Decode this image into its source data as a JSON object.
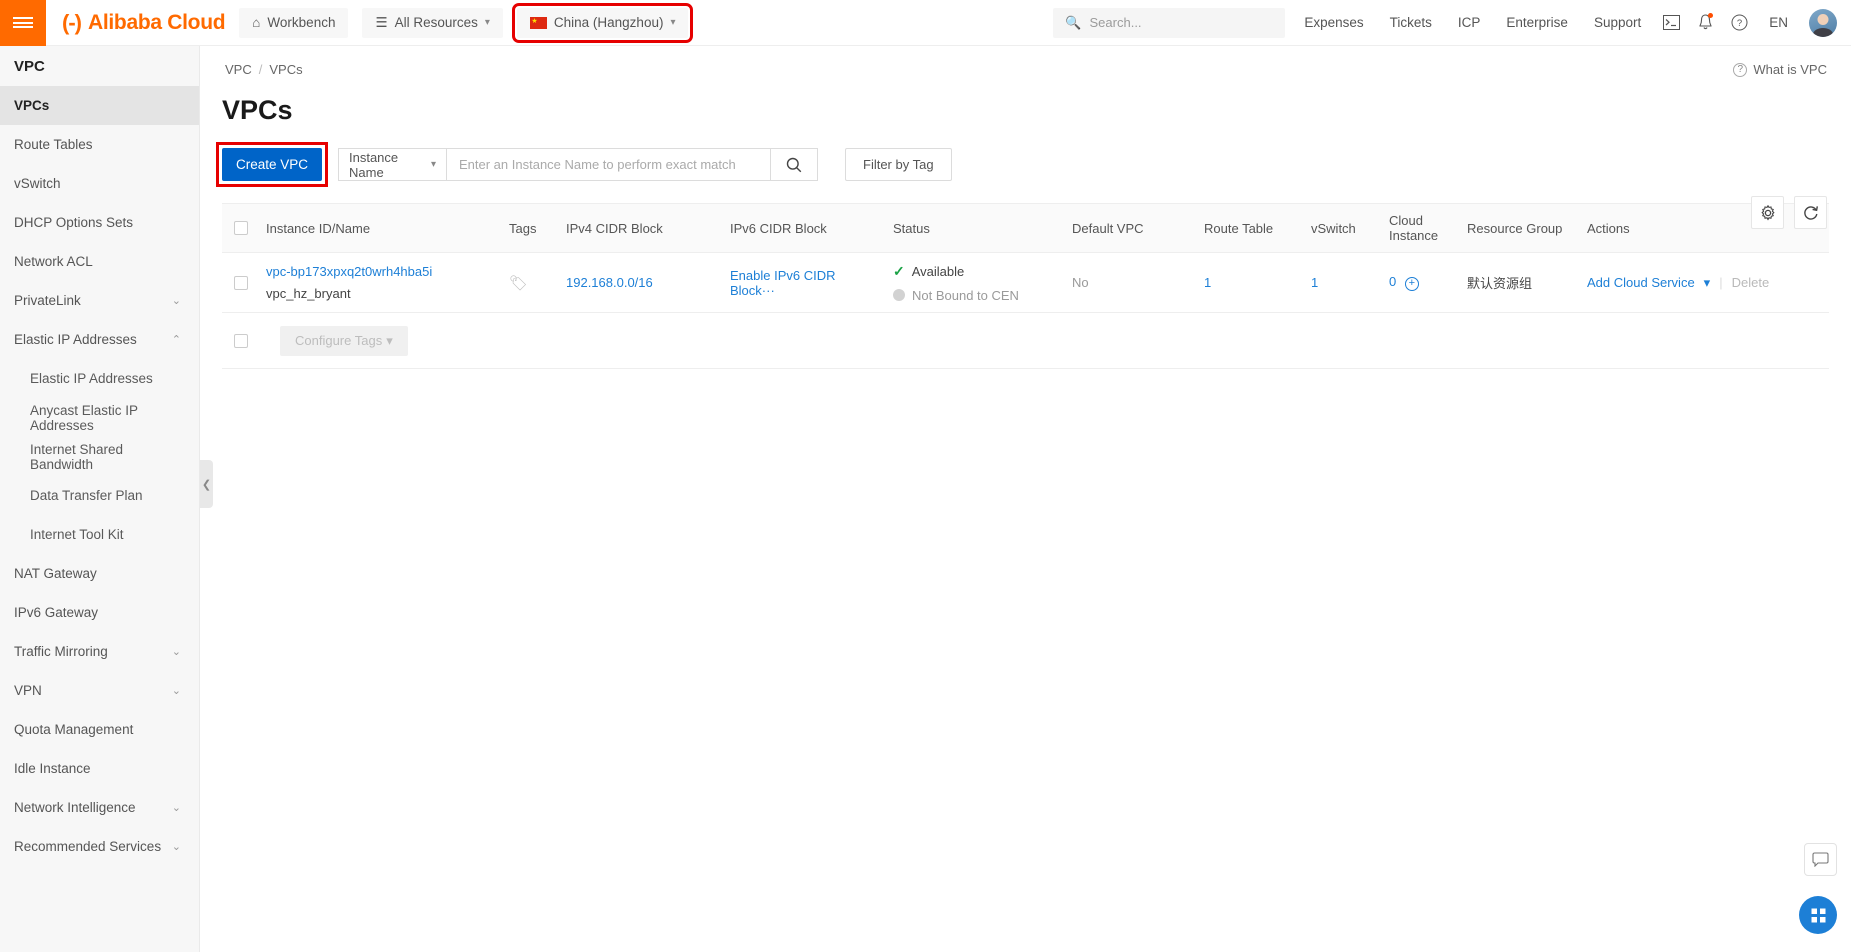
{
  "header": {
    "menu_icon": "hamburger-icon",
    "brand_logo": "(-)",
    "brand_text": "Alibaba Cloud",
    "workbench": "Workbench",
    "all_resources": "All Resources",
    "region": "China (Hangzhou)",
    "search_placeholder": "Search...",
    "links": [
      "Expenses",
      "Tickets",
      "ICP",
      "Enterprise",
      "Support"
    ],
    "lang": "EN",
    "icons": [
      "terminal-icon",
      "bell-icon",
      "help-icon"
    ],
    "highlight_color": "#e60000"
  },
  "sidebar": {
    "title": "VPC",
    "items": [
      {
        "label": "VPCs",
        "active": true,
        "sub": false,
        "chevron": ""
      },
      {
        "label": "Route Tables",
        "active": false,
        "sub": false,
        "chevron": ""
      },
      {
        "label": "vSwitch",
        "active": false,
        "sub": false,
        "chevron": ""
      },
      {
        "label": "DHCP Options Sets",
        "active": false,
        "sub": false,
        "chevron": ""
      },
      {
        "label": "Network ACL",
        "active": false,
        "sub": false,
        "chevron": ""
      },
      {
        "label": "PrivateLink",
        "active": false,
        "sub": false,
        "chevron": "⌄"
      },
      {
        "label": "Elastic IP Addresses",
        "active": false,
        "sub": false,
        "chevron": "⌃"
      },
      {
        "label": "Elastic IP Addresses",
        "active": false,
        "sub": true,
        "chevron": ""
      },
      {
        "label": "Anycast Elastic IP Addresses",
        "active": false,
        "sub": true,
        "chevron": ""
      },
      {
        "label": "Internet Shared Bandwidth",
        "active": false,
        "sub": true,
        "chevron": ""
      },
      {
        "label": "Data Transfer Plan",
        "active": false,
        "sub": true,
        "chevron": ""
      },
      {
        "label": "Internet Tool Kit",
        "active": false,
        "sub": true,
        "chevron": ""
      },
      {
        "label": "NAT Gateway",
        "active": false,
        "sub": false,
        "chevron": ""
      },
      {
        "label": "IPv6 Gateway",
        "active": false,
        "sub": false,
        "chevron": ""
      },
      {
        "label": "Traffic Mirroring",
        "active": false,
        "sub": false,
        "chevron": "⌄"
      },
      {
        "label": "VPN",
        "active": false,
        "sub": false,
        "chevron": "⌄"
      },
      {
        "label": "Quota Management",
        "active": false,
        "sub": false,
        "chevron": ""
      },
      {
        "label": "Idle Instance",
        "active": false,
        "sub": false,
        "chevron": ""
      },
      {
        "label": "Network Intelligence",
        "active": false,
        "sub": false,
        "chevron": "⌄"
      },
      {
        "label": "Recommended Services",
        "active": false,
        "sub": false,
        "chevron": "⌄"
      }
    ],
    "collapse_icon": "chevron-left-icon"
  },
  "main": {
    "breadcrumb": [
      "VPC",
      "VPCs"
    ],
    "what_is_vpc": "What is VPC",
    "page_title": "VPCs",
    "toolbar": {
      "create_label": "Create VPC",
      "filter_select": "Instance Name",
      "search_placeholder": "Enter an Instance Name to perform exact match",
      "filter_by_tag": "Filter by Tag",
      "settings_icon": "gear-icon",
      "refresh_icon": "refresh-icon"
    },
    "table": {
      "columns": [
        "Instance ID/Name",
        "Tags",
        "IPv4 CIDR Block",
        "IPv6 CIDR Block",
        "Status",
        "Default VPC",
        "Route Table",
        "vSwitch",
        "Cloud Instance",
        "Resource Group",
        "Actions"
      ],
      "cloud_instance_line1": "Cloud",
      "cloud_instance_line2": "Instance",
      "rows": [
        {
          "instance_id": "vpc-bp173xpxq2t0wrh4hba5i",
          "instance_name": "vpc_hz_bryant",
          "tags_icon": "tag-icon",
          "ipv4": "192.168.0.0/16",
          "ipv6": "Enable IPv6 CIDR Block···",
          "status_available": "Available",
          "status_cen": "Not Bound to CEN",
          "default_vpc": "No",
          "route_table": "1",
          "vswitch": "1",
          "cloud_instance": "0",
          "resource_group": "默认资源组",
          "action_primary": "Add Cloud Service",
          "action_delete": "Delete"
        }
      ]
    },
    "bulk": {
      "configure_tags": "Configure Tags"
    },
    "float": {
      "chat_icon": "chat-icon",
      "apps_icon": "apps-grid-icon"
    }
  }
}
